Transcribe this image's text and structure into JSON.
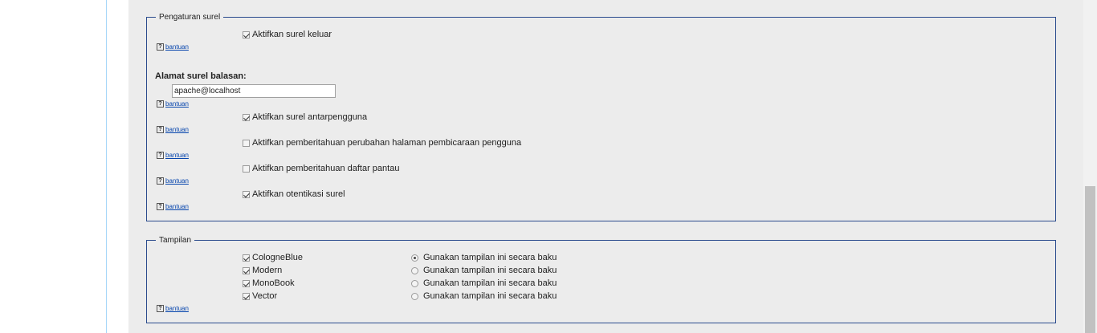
{
  "email_settings": {
    "legend": "Pengaturan surel",
    "enable_outgoing_label": "Aktifkan surel keluar",
    "reply_address_label": "Alamat surel balasan:",
    "reply_address_value": "apache@localhost",
    "enable_user_email_label": "Aktifkan surel antarpengguna",
    "enable_talk_notif_label": "Aktifkan pemberitahuan perubahan halaman pembicaraan pengguna",
    "enable_watchlist_notif_label": "Aktifkan pemberitahuan daftar pantau",
    "enable_email_auth_label": "Aktifkan otentikasi surel",
    "checked": {
      "outgoing": true,
      "user_email": true,
      "talk_notif": false,
      "watchlist_notif": false,
      "email_auth": true
    }
  },
  "skins": {
    "legend": "Tampilan",
    "items": [
      {
        "name": "CologneBlue",
        "enabled": true,
        "default": true
      },
      {
        "name": "Modern",
        "enabled": true,
        "default": false
      },
      {
        "name": "MonoBook",
        "enabled": true,
        "default": false
      },
      {
        "name": "Vector",
        "enabled": true,
        "default": false
      }
    ],
    "default_label": "Gunakan tampilan ini secara baku"
  },
  "help": {
    "icon_glyph": "?",
    "link_text": "bantuan"
  },
  "colors": {
    "fieldset_border": "#2a4b8d",
    "link": "#0645ad",
    "content_bg": "#ececec"
  }
}
